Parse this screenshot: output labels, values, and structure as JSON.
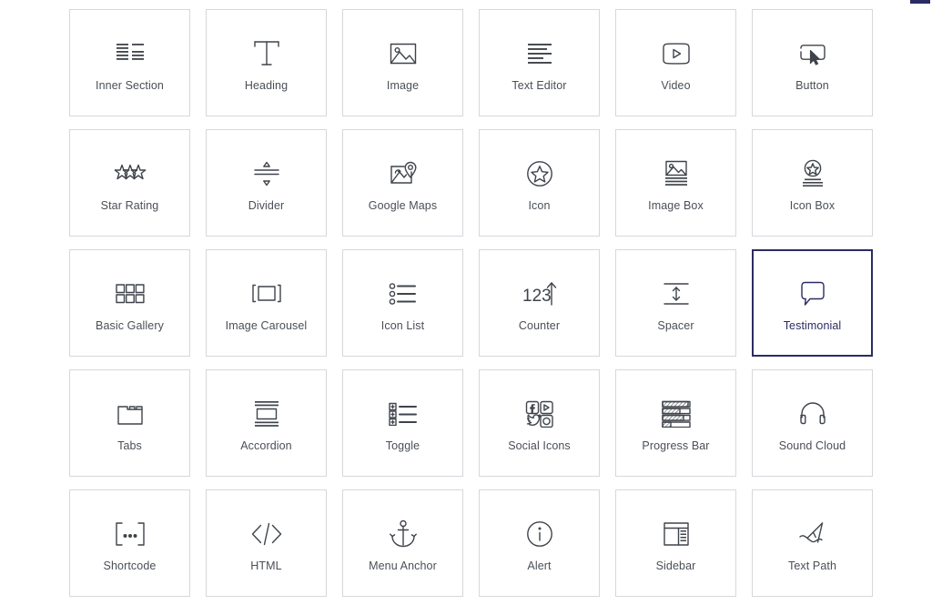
{
  "panel": {
    "accent_color": "#2b2b63",
    "card_border_color": "#d5d8dc",
    "label_color": "#4a4f57",
    "icon_color": "#3f444b",
    "background_color": "#ffffff",
    "columns": 6,
    "rows": 5
  },
  "widgets": [
    {
      "label": "Inner Section",
      "icon": "inner-section-icon",
      "selected": false
    },
    {
      "label": "Heading",
      "icon": "heading-icon",
      "selected": false
    },
    {
      "label": "Image",
      "icon": "image-icon",
      "selected": false
    },
    {
      "label": "Text Editor",
      "icon": "text-editor-icon",
      "selected": false
    },
    {
      "label": "Video",
      "icon": "video-icon",
      "selected": false
    },
    {
      "label": "Button",
      "icon": "button-icon",
      "selected": false
    },
    {
      "label": "Star Rating",
      "icon": "star-rating-icon",
      "selected": false
    },
    {
      "label": "Divider",
      "icon": "divider-icon",
      "selected": false
    },
    {
      "label": "Google Maps",
      "icon": "google-maps-icon",
      "selected": false
    },
    {
      "label": "Icon",
      "icon": "icon-star-circle-icon",
      "selected": false
    },
    {
      "label": "Image Box",
      "icon": "image-box-icon",
      "selected": false
    },
    {
      "label": "Icon Box",
      "icon": "icon-box-icon",
      "selected": false
    },
    {
      "label": "Basic Gallery",
      "icon": "basic-gallery-icon",
      "selected": false
    },
    {
      "label": "Image Carousel",
      "icon": "image-carousel-icon",
      "selected": false
    },
    {
      "label": "Icon List",
      "icon": "icon-list-icon",
      "selected": false
    },
    {
      "label": "Counter",
      "icon": "counter-icon",
      "selected": false
    },
    {
      "label": "Spacer",
      "icon": "spacer-icon",
      "selected": false
    },
    {
      "label": "Testimonial",
      "icon": "testimonial-icon",
      "selected": true
    },
    {
      "label": "Tabs",
      "icon": "tabs-icon",
      "selected": false
    },
    {
      "label": "Accordion",
      "icon": "accordion-icon",
      "selected": false
    },
    {
      "label": "Toggle",
      "icon": "toggle-icon",
      "selected": false
    },
    {
      "label": "Social Icons",
      "icon": "social-icons-icon",
      "selected": false
    },
    {
      "label": "Progress Bar",
      "icon": "progress-bar-icon",
      "selected": false
    },
    {
      "label": "Sound Cloud",
      "icon": "sound-cloud-icon",
      "selected": false
    },
    {
      "label": "Shortcode",
      "icon": "shortcode-icon",
      "selected": false
    },
    {
      "label": "HTML",
      "icon": "html-icon",
      "selected": false
    },
    {
      "label": "Menu Anchor",
      "icon": "menu-anchor-icon",
      "selected": false
    },
    {
      "label": "Alert",
      "icon": "alert-icon",
      "selected": false
    },
    {
      "label": "Sidebar",
      "icon": "sidebar-icon",
      "selected": false
    },
    {
      "label": "Text Path",
      "icon": "text-path-icon",
      "selected": false
    }
  ],
  "counter_icon_text": "123",
  "shortcode_icon_text": "[...]"
}
